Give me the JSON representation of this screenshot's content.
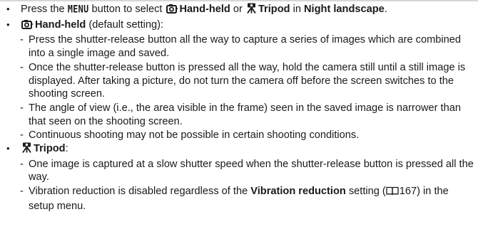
{
  "icons": {
    "handheld": "hand-held-camera-icon",
    "tripod": "tripod-icon",
    "reference": "book-reference-icon"
  },
  "bullet1": {
    "t1": "Press the ",
    "menu": "MENU",
    "t2": " button to select ",
    "handheld": "Hand-held",
    "t3": " or ",
    "tripod": "Tripod",
    "t4": " in ",
    "night": "Night landscape",
    "t5": "."
  },
  "handheld_section": {
    "label": "Hand-held",
    "suffix": " (default setting):",
    "items": [
      "Press the shutter-release button all the way to capture a series of images which are combined into a single image and saved.",
      "Once the shutter-release button is pressed all the way, hold the camera still until a still image is displayed. After taking a picture, do not turn the camera off before the screen switches to the shooting screen.",
      "The angle of view (i.e., the area visible in the frame) seen in the saved image is narrower than that seen on the shooting screen.",
      "Continuous shooting may not be possible in certain shooting conditions."
    ]
  },
  "tripod_section": {
    "label": "Tripod",
    "suffix": ":",
    "item1": "One image is captured at a slow shutter speed when the shutter-release button is pressed all the way.",
    "item2": {
      "t1": "Vibration reduction is disabled regardless of the ",
      "bold": "Vibration reduction",
      "t2": " setting (",
      "page": "167",
      "t3": ") in the setup menu."
    }
  }
}
